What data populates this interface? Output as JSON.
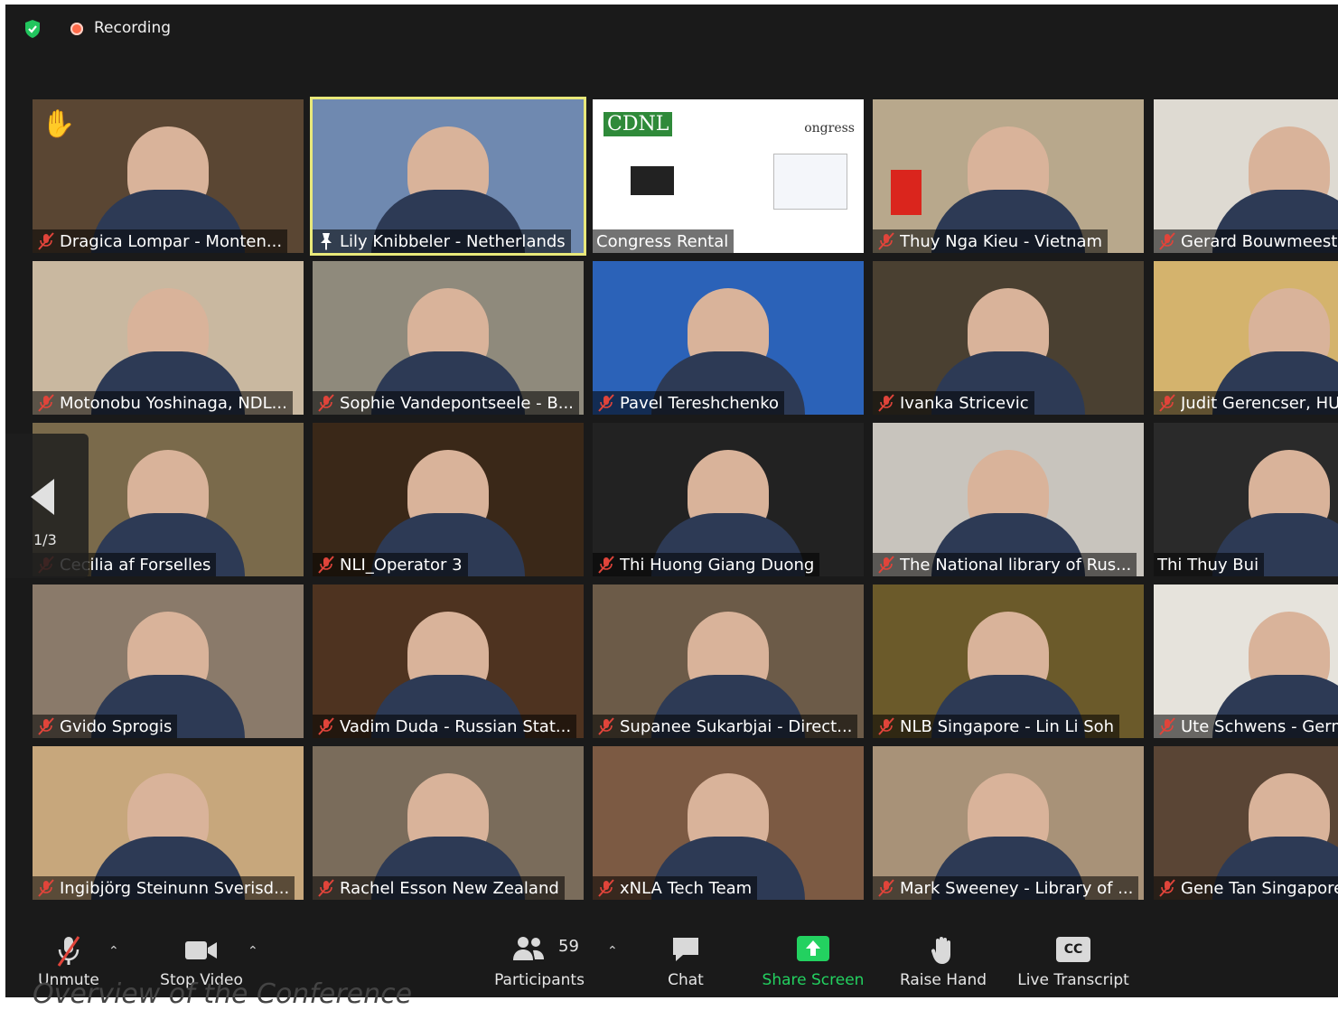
{
  "top": {
    "recording_label": "Recording"
  },
  "pager": {
    "page_indicator": "1/3"
  },
  "participants": [
    {
      "name": "Dragica Lompar - Monten...",
      "muted": true,
      "bg": "#5a4633"
    },
    {
      "name": "Lily Knibbeler - Netherlands",
      "muted": false,
      "pinned": true,
      "bg": "#6f89b0"
    },
    {
      "name": "Congress Rental",
      "muted": false,
      "bg": "#ffffff"
    },
    {
      "name": "Thuy Nga Kieu - Vietnam",
      "muted": true,
      "bg": "#b8a88c"
    },
    {
      "name": "Gerard Bouwmeester",
      "muted": true,
      "bg": "#dedad2"
    },
    {
      "name": "Motonobu Yoshinaga, NDL...",
      "muted": true,
      "bg": "#c9b8a0"
    },
    {
      "name": "Sophie Vandepontseele - B...",
      "muted": true,
      "bg": "#8f8a7c"
    },
    {
      "name": "Pavel Tereshchenko",
      "muted": true,
      "bg": "#2b62b8"
    },
    {
      "name": "Ivanka Stricevic",
      "muted": true,
      "bg": "#4a4031"
    },
    {
      "name": "Judit Gerencser, HU",
      "muted": true,
      "bg": "#d4b36d"
    },
    {
      "name": "Cecilia af Forselles",
      "muted": true,
      "bg": "#7a6a4b"
    },
    {
      "name": "NLI_Operator 3",
      "muted": true,
      "bg": "#3a2818"
    },
    {
      "name": "Thi Huong Giang Duong",
      "muted": true,
      "bg": "#222222"
    },
    {
      "name": "The National library of Rus...",
      "muted": true,
      "bg": "#c8c4bd"
    },
    {
      "name": "Thi Thuy Bui",
      "muted": false,
      "bg": "#2a2a2a"
    },
    {
      "name": "Gvido Sprogis",
      "muted": true,
      "bg": "#8a7a6a"
    },
    {
      "name": "Vadim Duda - Russian Stat...",
      "muted": true,
      "bg": "#4e3320"
    },
    {
      "name": "Supanee Sukarbjai - Direct...",
      "muted": true,
      "bg": "#6c5b48"
    },
    {
      "name": "NLB Singapore - Lin Li Soh",
      "muted": true,
      "bg": "#6b5a2a"
    },
    {
      "name": "Ute Schwens - Germany",
      "muted": true,
      "bg": "#e6e3dc"
    },
    {
      "name": "Ingibjörg Steinunn Sverisd...",
      "muted": true,
      "bg": "#c7a77c"
    },
    {
      "name": "Rachel Esson New Zealand",
      "muted": true,
      "bg": "#7a6c5b"
    },
    {
      "name": "xNLA Tech Team",
      "muted": true,
      "bg": "#7c5a43"
    },
    {
      "name": "Mark Sweeney - Library of ...",
      "muted": true,
      "bg": "#a89278"
    },
    {
      "name": "Gene Tan Singapore",
      "muted": true,
      "bg": "#5a4535"
    }
  ],
  "congress_slide": {
    "logo_left": "CDNL",
    "logo_right": "ongress"
  },
  "toolbar": {
    "unmute": "Unmute",
    "stop_video": "Stop Video",
    "participants_count": "59",
    "participants": "Participants",
    "chat": "Chat",
    "share_screen": "Share Screen",
    "raise_hand": "Raise Hand",
    "live_transcript": "Live Transcript",
    "cc": "CC"
  },
  "caption": "Overview of the Conference",
  "colors": {
    "share_green": "#23d160",
    "muted_red": "#e0443a",
    "hand_yellow": "#f5c542",
    "active_border": "#e8e87a"
  }
}
